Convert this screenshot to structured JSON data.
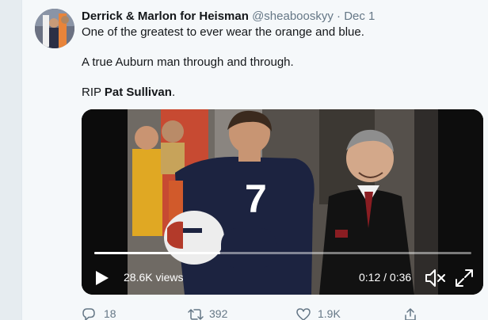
{
  "tweet": {
    "author": {
      "display_name": "Derrick & Marlon for Heisman",
      "handle": "@sheabooskyy",
      "separator": "·",
      "date": "Dec 1"
    },
    "lines": {
      "line1": "One of the greatest to ever wear the orange and blue.",
      "line2": "A true Auburn man through and through.",
      "line3_prefix": "RIP ",
      "line3_name": "Pat Sullivan",
      "line3_suffix": "."
    },
    "video": {
      "views": "28.6K views",
      "time": "0:12 / 0:36",
      "progress": 0.333,
      "jersey_number": "7"
    },
    "actions": {
      "reply_count": "18",
      "retweet_count": "392",
      "like_count": "1.9K"
    }
  },
  "colors": {
    "text_primary": "#14171a",
    "text_secondary": "#657786",
    "jersey_navy": "#1c2340",
    "background": "#f5f8fa"
  },
  "icons": [
    "reply-icon",
    "retweet-icon",
    "like-icon",
    "share-icon",
    "play-icon",
    "volume-icon",
    "fullscreen-icon"
  ]
}
